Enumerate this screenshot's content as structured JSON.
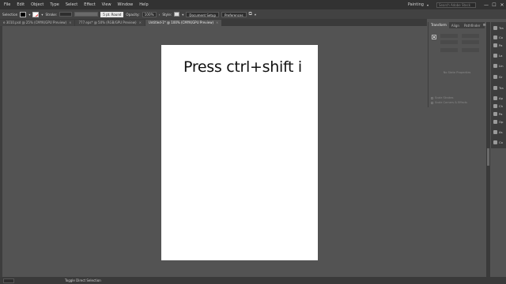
{
  "menubar": {
    "items": [
      "File",
      "Edit",
      "Object",
      "Type",
      "Select",
      "Effect",
      "View",
      "Window",
      "Help"
    ],
    "workspace": "Painting",
    "search_placeholder": "Search Adobe Stock",
    "window_controls": [
      "—",
      "☐",
      "✕"
    ]
  },
  "control_bar": {
    "selection_label": "Selection",
    "stroke_label": "Stroke:",
    "brush_label": "5 pt. Round",
    "opacity_label": "Opacity:",
    "opacity_value": "100%",
    "style_label": "Style:",
    "document_setup": "Document Setup",
    "preferences": "Preferences"
  },
  "tabs": [
    {
      "label": "e 3010.psd @ 25% (CMYK/GPU Preview)",
      "active": false
    },
    {
      "label": "777.eps* @ 50% (RGB/GPU Preview)",
      "active": false
    },
    {
      "label": "Untitled-1* @ 100% (CMYK/GPU Preview)",
      "active": true
    }
  ],
  "artboard": {
    "text": "Press ctrl+shift i"
  },
  "transform_panel": {
    "tabs": [
      "Transform",
      "Align",
      "Pathfinder"
    ],
    "empty_state": "No State Properties",
    "option_1": "Scale Strokes",
    "option_2": "Scale Corners & Effects"
  },
  "icon_panel": {
    "items": [
      "Tra",
      "Co",
      "Pa",
      "La",
      "Lin",
      "Gr",
      "Tra",
      "Ap",
      "Ch",
      "Pa",
      "Op",
      "As",
      "Co"
    ]
  },
  "status_bar": {
    "tool": "Toggle Direct Selection"
  },
  "colors": {
    "canvas": "#535353",
    "artboard": "#ffffff",
    "chrome": "#323232"
  }
}
